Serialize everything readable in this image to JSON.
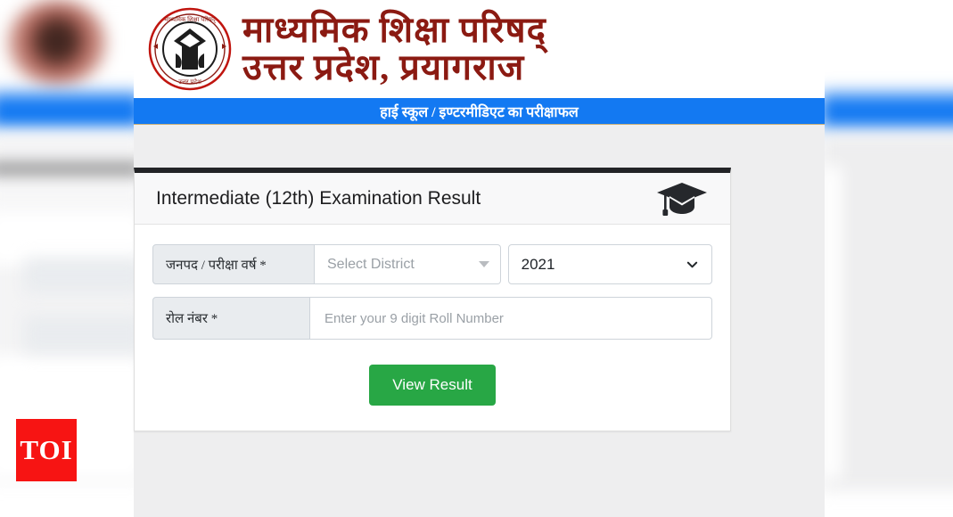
{
  "header": {
    "emblem_alt": "board-emblem",
    "hindi_line1": "माध्यमिक  शिक्षा  परिषद्",
    "hindi_line2": "उत्तर  प्रदेश,  प्रयागराज",
    "banner_text": "हाई स्कूल / इण्टरमीडिएट का परीक्षाफल",
    "banner_color": "#1379f2",
    "title_color": "#8b1a12"
  },
  "card": {
    "title": "Intermediate (12th) Examination Result",
    "icon": "graduation-cap-icon",
    "top_border_color": "#222326"
  },
  "form": {
    "district_row": {
      "label": "जनपद / परीक्षा वर्ष *",
      "district_placeholder": "Select District",
      "district_icon": "caret-down-icon",
      "year_value": "2021",
      "year_icon": "chevron-down-icon"
    },
    "roll_row": {
      "label": "रोल नंबर *",
      "placeholder": "Enter your 9 digit Roll Number",
      "value": ""
    },
    "submit": {
      "label": "View Result",
      "color": "#28a745"
    }
  },
  "watermark": {
    "text": "TOI",
    "color": "#f71413"
  }
}
